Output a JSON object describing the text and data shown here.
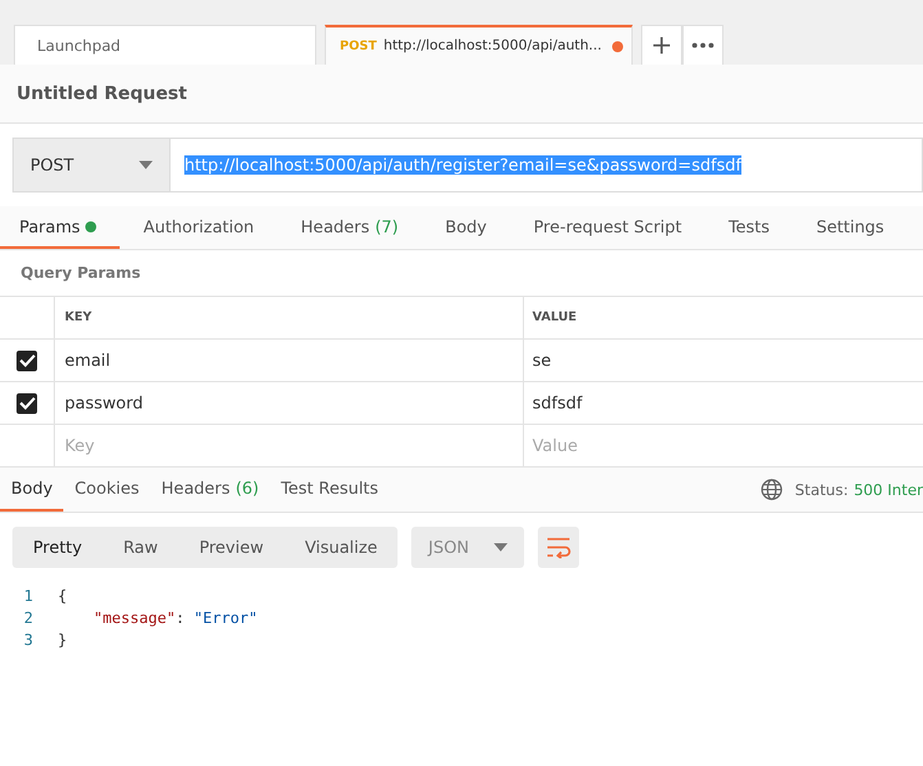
{
  "tabs": [
    {
      "label": "Launchpad",
      "selected": false,
      "modified": false
    },
    {
      "method": "POST",
      "label": "http://localhost:5000/api/auth...",
      "selected": true,
      "modified": true
    }
  ],
  "request": {
    "title": "Untitled Request",
    "method": "POST",
    "url": "http://localhost:5000/api/auth/register?email=se&password=sdfsdf"
  },
  "request_tabs": [
    {
      "label": "Params",
      "dot": true,
      "selected": true
    },
    {
      "label": "Authorization",
      "dot": false,
      "selected": false
    },
    {
      "label": "Headers",
      "count": "(7)",
      "dot": false,
      "selected": false
    },
    {
      "label": "Body",
      "dot": false,
      "selected": false
    },
    {
      "label": "Pre-request Script",
      "dot": false,
      "selected": false
    },
    {
      "label": "Tests",
      "dot": false,
      "selected": false
    },
    {
      "label": "Settings",
      "dot": false,
      "selected": false
    }
  ],
  "query_params": {
    "title": "Query Params",
    "columns": [
      "KEY",
      "VALUE"
    ],
    "rows": [
      {
        "key": "email",
        "value": "se",
        "checked": true
      },
      {
        "key": "password",
        "value": "sdfsdf",
        "checked": true
      }
    ],
    "new_row": {
      "key_placeholder": "Key",
      "value_placeholder": "Value"
    }
  },
  "response_tabs": [
    {
      "label": "Body",
      "selected": true
    },
    {
      "label": "Cookies",
      "selected": false
    },
    {
      "label": "Headers",
      "count": "(6)",
      "selected": false
    },
    {
      "label": "Test Results",
      "selected": false
    }
  ],
  "status": {
    "label": "Status:",
    "value": "500 Inter"
  },
  "view_modes": [
    {
      "label": "Pretty",
      "selected": true
    },
    {
      "label": "Raw",
      "selected": false
    },
    {
      "label": "Preview",
      "selected": false
    },
    {
      "label": "Visualize",
      "selected": false
    }
  ],
  "format": "JSON",
  "wrap_on": true,
  "code_lines": [
    {
      "number": "1",
      "tokens": [
        {
          "kind": "punct",
          "text": "{"
        }
      ]
    },
    {
      "number": "2",
      "tokens": [
        {
          "kind": "key",
          "text": "\"message\""
        },
        {
          "kind": "punct",
          "text": ": "
        },
        {
          "kind": "string",
          "text": "\"Error\""
        }
      ]
    },
    {
      "number": "3",
      "tokens": [
        {
          "kind": "punct",
          "text": "}"
        }
      ]
    }
  ]
}
